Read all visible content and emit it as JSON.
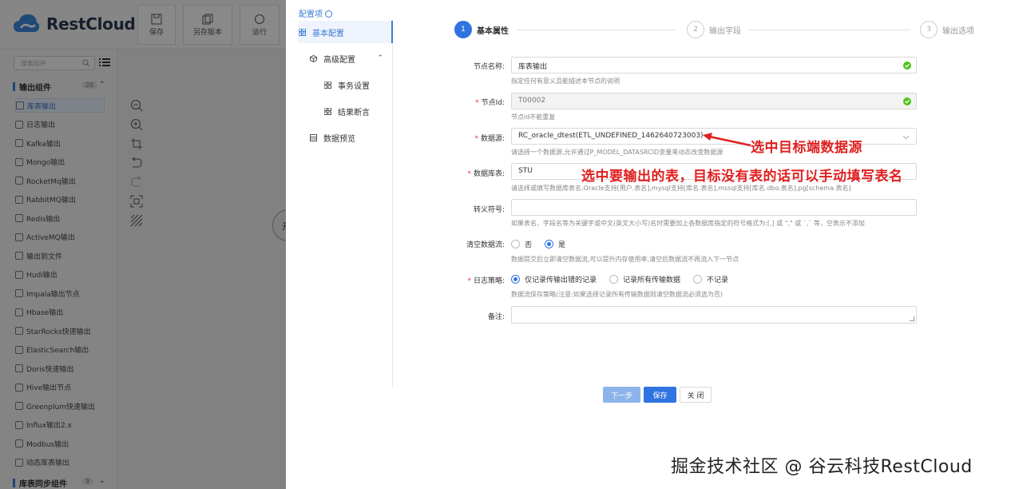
{
  "app": {
    "logo_text": "RestCloud",
    "toolbar": [
      {
        "label": "保存",
        "icon": "save-icon"
      },
      {
        "label": "另存版本",
        "icon": "copy-icon"
      },
      {
        "label": "运行",
        "icon": "run-icon"
      }
    ],
    "search_placeholder": "搜索组件",
    "group_output": {
      "label": "输出组件",
      "count": "20"
    },
    "components": [
      "库表输出",
      "日志输出",
      "Kafka输出",
      "Mongo输出",
      "RocketMq输出",
      "RabbitMQ输出",
      "Redis输出",
      "ActiveMQ输出",
      "输出到文件",
      "Hudi输出",
      "Impala输出节点",
      "Hbase输出",
      "StarRocks快速输出",
      "ElasticSearch输出",
      "Doris快速输出",
      "Hive输出节点",
      "Greenplum快速输出",
      "Influx输出2.x",
      "Modbus输出",
      "动态库表输出"
    ],
    "group_sync": {
      "label": "库表同步组件",
      "count": "9"
    },
    "canvas_node_char": "开"
  },
  "drawer": {
    "config_title": "配置项",
    "menu": [
      {
        "label": "基本配置",
        "icon": "grid-icon",
        "active": true
      },
      {
        "label": "高级配置",
        "icon": "cube-icon",
        "active": false
      },
      {
        "label": "事务设置",
        "icon": "grid-icon",
        "active": false
      },
      {
        "label": "结果断言",
        "icon": "grid-icon",
        "active": false
      },
      {
        "label": "数据预览",
        "icon": "table-icon",
        "active": false
      }
    ],
    "steps": [
      {
        "num": "1",
        "label": "基本属性"
      },
      {
        "num": "2",
        "label": "输出字段"
      },
      {
        "num": "3",
        "label": "输出选项"
      }
    ],
    "form": {
      "node_name": {
        "label": "节点名称:",
        "value": "库表输出",
        "help": "指定任何有意义且能描述本节点的说明"
      },
      "node_id": {
        "label": "节点Id:",
        "value": "T00002",
        "help": "节点id不能重复"
      },
      "datasource": {
        "label": "数据源:",
        "value": "RC_oracle_dtest(ETL_UNDEFINED_1462640723003)",
        "help": "请选择一个数据源,允许通过P_MODEL_DATASRCID变量来动态改变数据源"
      },
      "table": {
        "label": "数据库表:",
        "value": "STU",
        "help": "请选择或填写数据库表名,Oracle支持[用户.表名],mysql支持[库名.表名],mssql支持[库名.dbo.表名],pg[schema.表名]"
      },
      "escape": {
        "label": "转义符号:",
        "value": "",
        "help": "如果表名、字段名等为关键字或中文(英文大小写)名时需要加上各数据库指定的符号格式为:[,] 或 \",\" 或 `,` 等，空表示不添加"
      },
      "clear": {
        "label": "清空数据流:",
        "options": [
          "否",
          "是"
        ],
        "help": "数据提交后立即清空数据流,可以提升内存使用率,清空后数据流不再流入下一节点"
      },
      "log": {
        "label": "日志策略:",
        "options": [
          "仅记录传输出错的记录",
          "记录所有传输数据",
          "不记录"
        ],
        "help": "数据流保存策略(注意:如果选择记录所有传输数据则清空数据流必须选为否)"
      },
      "remark": {
        "label": "备注:"
      }
    },
    "buttons": {
      "next": "下一步",
      "save": "保存",
      "close": "关 闭"
    },
    "annotations": {
      "datasource": "选中目标端数据源",
      "table": "选中要输出的表，目标没有表的话可以手动填写表名"
    }
  },
  "watermark": "掘金技术社区 @ 谷云科技RestCloud",
  "colors": {
    "primary": "#2f74e0",
    "annotation": "#e02020",
    "success": "#52c41a"
  }
}
